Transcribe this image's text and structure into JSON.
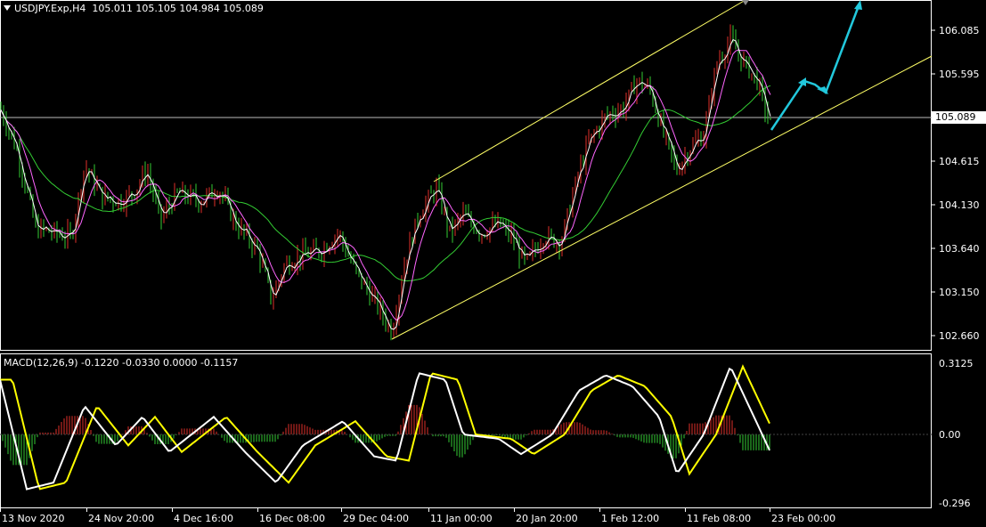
{
  "header": {
    "symbol": "USDJPY.Exp,H4",
    "open": "105.011",
    "high": "105.105",
    "low": "104.984",
    "close": "105.089"
  },
  "macd": {
    "label": "MACD(12,26,9)",
    "values": "-0.1220 -0.0330 0.0000 -0.1157"
  },
  "current_price": "105.089",
  "price_axis": [
    "106.085",
    "105.595",
    "104.615",
    "104.130",
    "103.640",
    "103.150",
    "102.660"
  ],
  "macd_axis": [
    "0.3125",
    "0.00",
    "-0.296"
  ],
  "time_axis": [
    "13 Nov 2020",
    "24 Nov 20:00",
    "4 Dec 16:00",
    "16 Dec 08:00",
    "29 Dec 04:00",
    "11 Jan 00:00",
    "20 Jan 20:00",
    "1 Feb 12:00",
    "11 Feb 08:00",
    "23 Feb 00:00"
  ],
  "colors": {
    "background": "#000000",
    "bull_candle": "#e0302a",
    "bear_candle": "#33cc33",
    "fast_ma": "#ffffff",
    "mid_ma": "#ff66ff",
    "slow_ma": "#33cc33",
    "channel": "#ffff66",
    "macd_line": "#ffffff",
    "signal_line": "#ffff00",
    "forecast_arrow": "#22c8dc"
  },
  "chart_data": {
    "type": "line",
    "title": "USDJPY.Exp,H4",
    "xlabel": "",
    "ylabel": "",
    "ylim": [
      102.5,
      106.4
    ],
    "close_series": [
      {
        "t": "13 Nov 2020",
        "y": 105.1
      },
      {
        "t": "24 Nov 20:00",
        "y": 104.45
      },
      {
        "t": "4 Dec 16:00",
        "y": 104.2
      },
      {
        "t": "16 Dec 08:00",
        "y": 103.35
      },
      {
        "t": "29 Dec 04:00",
        "y": 103.55
      },
      {
        "t": "11 Jan 00:00",
        "y": 104.05
      },
      {
        "t": "20 Jan 20:00",
        "y": 103.75
      },
      {
        "t": "1 Feb 12:00",
        "y": 105.55
      },
      {
        "t": "11 Feb 08:00",
        "y": 105.8
      },
      {
        "t": "23 Feb 00:00",
        "y": 105.089
      }
    ],
    "channel_upper": [
      {
        "t": "11 Jan 00:00",
        "y": 104.35
      },
      {
        "t": "11 Feb 08:00",
        "y": 106.4
      }
    ],
    "channel_lower": [
      {
        "t": "29 Dec 04:00",
        "y": 102.6
      },
      {
        "t": "23 Feb 00:00",
        "y": 104.85
      }
    ],
    "macd_ylim": [
      -0.296,
      0.3125
    ]
  }
}
